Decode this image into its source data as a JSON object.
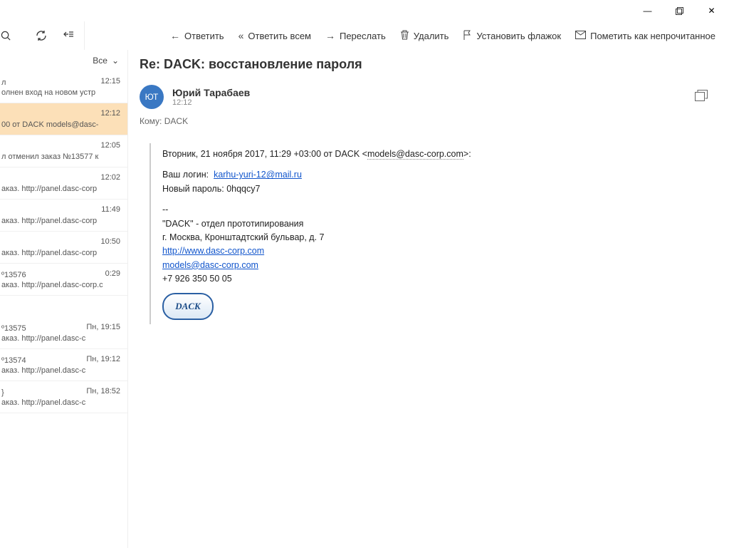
{
  "window": {
    "min": "—",
    "max": "▢",
    "close": "✕"
  },
  "toolbar": {
    "reply": "Ответить",
    "reply_all": "Ответить всем",
    "forward": "Переслать",
    "delete": "Удалить",
    "flag": "Установить флажок",
    "unread": "Пометить как непрочитанное"
  },
  "sidebar": {
    "all": "Все",
    "items": [
      {
        "line1": "л",
        "line2": "олнен вход на новом устр",
        "time": "12:15",
        "sel": false
      },
      {
        "line1": "",
        "line2": "00 от DACK models@dasc-",
        "time": "12:12",
        "sel": true
      },
      {
        "line1": "",
        "line2": "л отменил заказ №13577 к",
        "time": "12:05",
        "sel": false
      },
      {
        "line1": "",
        "line2": "аказ. http://panel.dasc-corp",
        "time": "12:02",
        "sel": false
      },
      {
        "line1": "",
        "line2": "аказ. http://panel.dasc-corp",
        "time": "11:49",
        "sel": false
      },
      {
        "line1": "",
        "line2": "аказ. http://panel.dasc-corp",
        "time": "10:50",
        "sel": false
      },
      {
        "line1": "º13576",
        "line2": "аказ. http://panel.dasc-corp.c",
        "time": "0:29",
        "sel": false
      }
    ],
    "items2": [
      {
        "line1": "º13575",
        "line2": "аказ. http://panel.dasc-c",
        "time": "Пн, 19:15"
      },
      {
        "line1": "º13574",
        "line2": "аказ. http://panel.dasc-c",
        "time": "Пн, 19:12"
      },
      {
        "line1": "}",
        "line2": "аказ. http://panel.dasc-c",
        "time": "Пн, 18:52"
      }
    ]
  },
  "message": {
    "subject": "Re: DACK: восстановление пароля",
    "sender": "Юрий Тарабаев",
    "initials": "ЮТ",
    "time": "12:12",
    "to_label": "Кому:",
    "to": "DACK",
    "quote_header_pre": "Вторник, 21 ноября 2017, 11:29 +03:00 от DACK <",
    "quote_header_email": "models@dasc-corp.com",
    "quote_header_post": ">:",
    "login_label": "Ваш логин:",
    "login": "karhu-yuri-12@mail.ru",
    "password_label": "Новый пароль:",
    "password": "0hqqcy7",
    "sig1": "--",
    "sig2": "\"DACK\" - отдел прототипирования",
    "sig3": "г. Москва, Кронштадтский бульвар, д. 7",
    "url": "http://www.dasc-corp.com",
    "email": "models@dasc-corp.com",
    "phone": "+7 926 350 50 05",
    "logo_text": "DACK"
  }
}
